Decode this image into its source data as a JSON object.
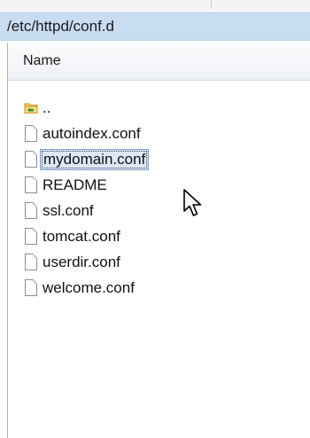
{
  "window": {
    "path": "/etc/httpd/conf.d"
  },
  "list": {
    "column_header": "Name",
    "selected_index": 3,
    "items": [
      {
        "label": "..",
        "icon": "folder-up-icon",
        "name": "parent-directory"
      },
      {
        "label": "autoindex.conf",
        "icon": "file-icon",
        "name": "autoindex-conf"
      },
      {
        "label": "mydomain.conf",
        "icon": "file-icon",
        "name": "mydomain-conf"
      },
      {
        "label": "README",
        "icon": "file-icon",
        "name": "readme"
      },
      {
        "label": "ssl.conf",
        "icon": "file-icon",
        "name": "ssl-conf"
      },
      {
        "label": "tomcat.conf",
        "icon": "file-icon",
        "name": "tomcat-conf"
      },
      {
        "label": "userdir.conf",
        "icon": "file-icon",
        "name": "userdir-conf"
      },
      {
        "label": "welcome.conf",
        "icon": "file-icon",
        "name": "welcome-conf"
      }
    ]
  },
  "colors": {
    "path_bar_bg": "#c8dcf2",
    "selection_bg": "#dde9f8",
    "selection_border": "#7da2ce"
  }
}
